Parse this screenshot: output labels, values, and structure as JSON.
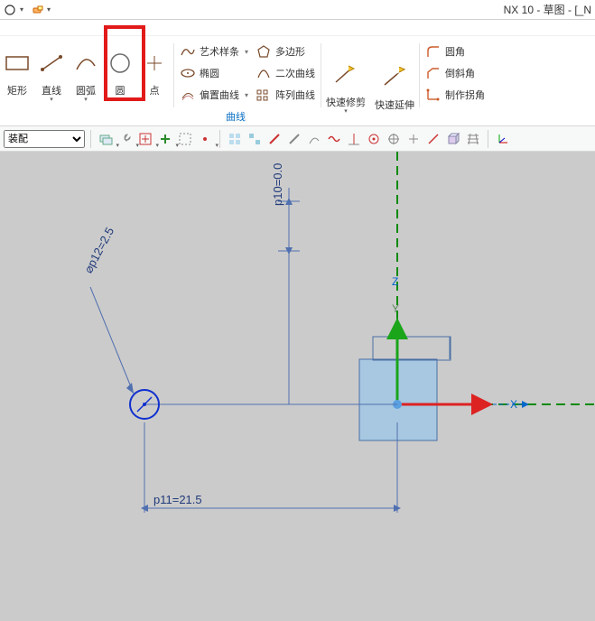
{
  "app_title": "NX 10 - 草图 - [_N",
  "ribbon": {
    "rectangle": "矩形",
    "line": "直线",
    "arc": "圆弧",
    "circle": "圆",
    "point": "点",
    "art_spline": "艺术样条",
    "ellipse": "椭圆",
    "offset_curve": "偏置曲线",
    "polygon": "多边形",
    "conic": "二次曲线",
    "pattern_curve": "阵列曲线",
    "quick_trim": "快速修剪",
    "quick_extend": "快速延伸",
    "fillet": "圆角",
    "chamfer": "倒斜角",
    "make_corner": "制作拐角",
    "group_label": "曲线"
  },
  "toolbar2": {
    "assembly_label": "装配"
  },
  "sketch": {
    "dim_p10": "p10=0.0",
    "dim_p11": "p11=21.5",
    "dim_p12": "p12=2.5",
    "diameter_prefix": "⌀"
  }
}
